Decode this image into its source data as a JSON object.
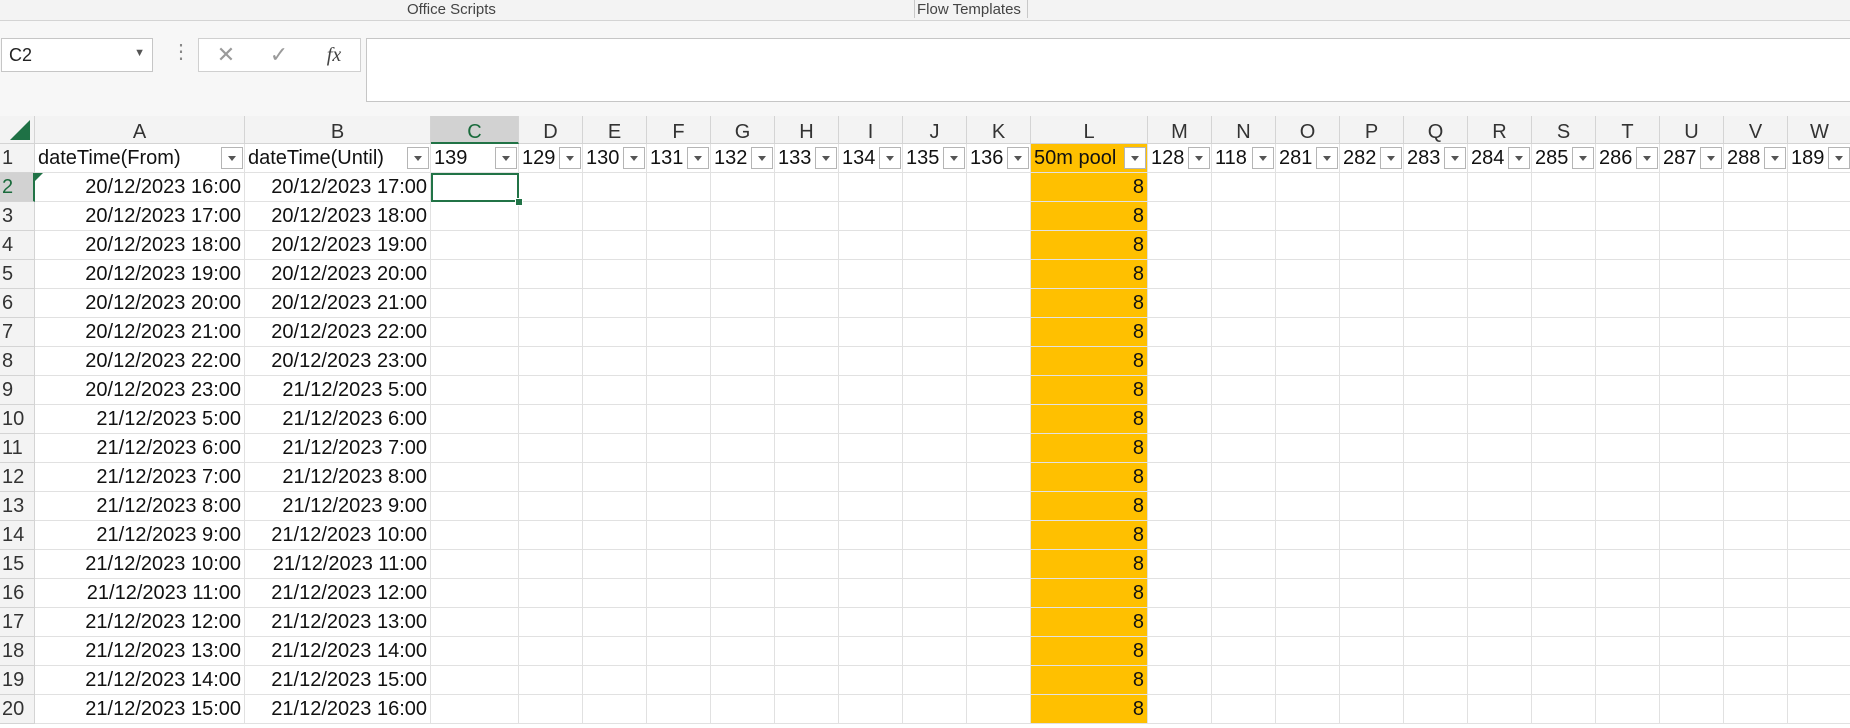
{
  "ribbon": {
    "office_scripts": "Office Scripts",
    "flow_templates": "Flow Templates"
  },
  "formula_bar": {
    "name_box": "C2",
    "cancel_glyph": "✕",
    "enter_glyph": "✓",
    "function_glyph": "fx",
    "formula": ""
  },
  "grid": {
    "columns": [
      "A",
      "B",
      "C",
      "D",
      "E",
      "F",
      "G",
      "H",
      "I",
      "J",
      "K",
      "L",
      "M",
      "N",
      "O",
      "P",
      "Q",
      "R",
      "S",
      "T",
      "U",
      "V",
      "W"
    ],
    "active_column": "C",
    "active_row": "2",
    "headers": [
      "dateTime(From)",
      "dateTime(Until)",
      "139",
      "129",
      "130",
      "131",
      "132",
      "133",
      "134",
      "135",
      "136",
      "50m pool",
      "128",
      "118",
      "281",
      "282",
      "283",
      "284",
      "285",
      "286",
      "287",
      "288",
      "189"
    ],
    "rows": [
      {
        "num": "2",
        "from": "20/12/2023 16:00",
        "until": "20/12/2023 17:00",
        "pool": "8"
      },
      {
        "num": "3",
        "from": "20/12/2023 17:00",
        "until": "20/12/2023 18:00",
        "pool": "8"
      },
      {
        "num": "4",
        "from": "20/12/2023 18:00",
        "until": "20/12/2023 19:00",
        "pool": "8"
      },
      {
        "num": "5",
        "from": "20/12/2023 19:00",
        "until": "20/12/2023 20:00",
        "pool": "8"
      },
      {
        "num": "6",
        "from": "20/12/2023 20:00",
        "until": "20/12/2023 21:00",
        "pool": "8"
      },
      {
        "num": "7",
        "from": "20/12/2023 21:00",
        "until": "20/12/2023 22:00",
        "pool": "8"
      },
      {
        "num": "8",
        "from": "20/12/2023 22:00",
        "until": "20/12/2023 23:00",
        "pool": "8"
      },
      {
        "num": "9",
        "from": "20/12/2023 23:00",
        "until": "21/12/2023 5:00",
        "pool": "8"
      },
      {
        "num": "10",
        "from": "21/12/2023 5:00",
        "until": "21/12/2023 6:00",
        "pool": "8"
      },
      {
        "num": "11",
        "from": "21/12/2023 6:00",
        "until": "21/12/2023 7:00",
        "pool": "8"
      },
      {
        "num": "12",
        "from": "21/12/2023 7:00",
        "until": "21/12/2023 8:00",
        "pool": "8"
      },
      {
        "num": "13",
        "from": "21/12/2023 8:00",
        "until": "21/12/2023 9:00",
        "pool": "8"
      },
      {
        "num": "14",
        "from": "21/12/2023 9:00",
        "until": "21/12/2023 10:00",
        "pool": "8"
      },
      {
        "num": "15",
        "from": "21/12/2023 10:00",
        "until": "21/12/2023 11:00",
        "pool": "8"
      },
      {
        "num": "16",
        "from": "21/12/2023 11:00",
        "until": "21/12/2023 12:00",
        "pool": "8"
      },
      {
        "num": "17",
        "from": "21/12/2023 12:00",
        "until": "21/12/2023 13:00",
        "pool": "8"
      },
      {
        "num": "18",
        "from": "21/12/2023 13:00",
        "until": "21/12/2023 14:00",
        "pool": "8"
      },
      {
        "num": "19",
        "from": "21/12/2023 14:00",
        "until": "21/12/2023 15:00",
        "pool": "8"
      },
      {
        "num": "20",
        "from": "21/12/2023 15:00",
        "until": "21/12/2023 16:00",
        "pool": "8"
      }
    ]
  },
  "colors": {
    "highlight_fill": "#ffc000",
    "accent": "#217346",
    "gridline": "#e1e1e1",
    "header_bg": "#f3f3f3"
  }
}
